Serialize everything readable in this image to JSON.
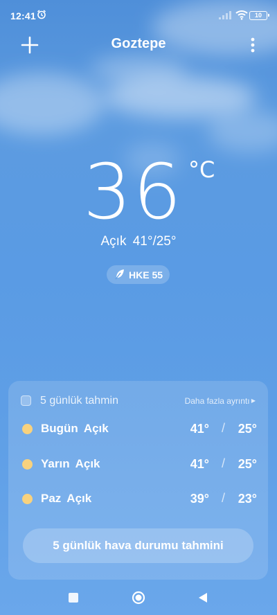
{
  "status": {
    "time": "12:41",
    "battery": "10"
  },
  "header": {
    "city": "Goztepe"
  },
  "current": {
    "temp": "36",
    "unit": "°C",
    "condition": "Açık",
    "range": "41°/25°",
    "aqi_label": "HKE 55"
  },
  "forecast": {
    "title": "5 günlük tahmin",
    "more_label": "Daha fazla ayrıntı",
    "days": [
      {
        "day": "Bugün",
        "condition": "Açık",
        "high": "41°",
        "low": "25°"
      },
      {
        "day": "Yarın",
        "condition": "Açık",
        "high": "41°",
        "low": "25°"
      },
      {
        "day": "Paz",
        "condition": "Açık",
        "high": "39°",
        "low": "23°"
      }
    ],
    "button_label": "5 günlük hava durumu tahmini",
    "sun_color": "#f8d27e"
  }
}
